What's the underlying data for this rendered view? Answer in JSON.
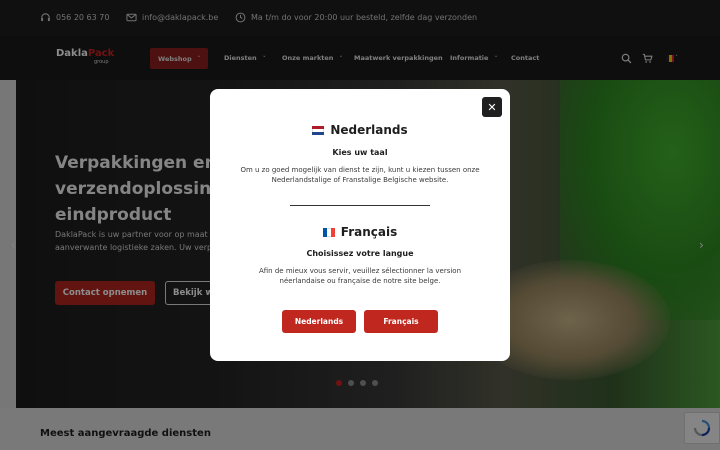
{
  "topbar": {
    "phone": "056 20 63 70",
    "email": "info@daklapack.be",
    "delivery": "Ma t/m do voor 20:00 uur besteld, zelfde dag verzonden"
  },
  "logo": {
    "dakla": "Dakla",
    "pack": "Pack",
    "group": "group"
  },
  "nav": {
    "items": [
      "Webshop",
      "Diensten",
      "Onze markten",
      "Maatwerk verpakkingen",
      "Informatie",
      "Contact"
    ],
    "chevron": "˅"
  },
  "hero": {
    "title": "Verpakkingen en verzendoplossing eindproduct",
    "desc": "DaklaPack is uw partner voor op maat aanverwante logistieke zaken. Uw verp",
    "btn_primary": "Contact opnemen",
    "btn_secondary": "Bekijk w",
    "arrow_left": "‹",
    "arrow_right": "›"
  },
  "modal": {
    "close": "✕",
    "nl": {
      "heading": "Nederlands",
      "sub": "Kies uw taal",
      "text": "Om u zo goed mogelijk van dienst te zijn, kunt u kiezen tussen onze Nederlandstalige of Franstalige Belgische website."
    },
    "fr": {
      "heading": "Français",
      "sub": "Choisissez votre langue",
      "text": "Afin de mieux vous servir, veuillez sélectionner la version néerlandaise ou française de notre site belge."
    },
    "btn_nl": "Nederlands",
    "btn_fr": "Français"
  },
  "bottom": {
    "title": "Meest aangevraagde diensten"
  },
  "colors": {
    "accent": "#c0271f",
    "dark": "#1a1a1a"
  }
}
